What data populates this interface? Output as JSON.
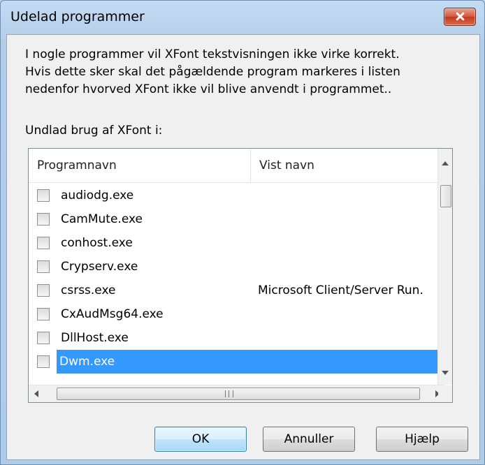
{
  "window": {
    "title": "Udelad programmer"
  },
  "description": [
    "I nogle programmer vil XFont tekstvisningen ikke virke korrekt.",
    "Hvis dette sker skal det pågældende program markeres i listen",
    "nedenfor hvorved XFont ikke vil blive anvendt i programmet.."
  ],
  "list_label": "Undlad brug af XFont i:",
  "columns": [
    "Programnavn",
    "Vist navn"
  ],
  "rows": [
    {
      "name": "audiodg.exe",
      "display": "",
      "checked": false,
      "selected": false
    },
    {
      "name": "CamMute.exe",
      "display": "",
      "checked": false,
      "selected": false
    },
    {
      "name": "conhost.exe",
      "display": "",
      "checked": false,
      "selected": false
    },
    {
      "name": "Crypserv.exe",
      "display": "",
      "checked": false,
      "selected": false
    },
    {
      "name": "csrss.exe",
      "display": "Microsoft Client/Server Run.",
      "checked": false,
      "selected": false
    },
    {
      "name": "CxAudMsg64.exe",
      "display": "",
      "checked": false,
      "selected": false
    },
    {
      "name": "DllHost.exe",
      "display": "",
      "checked": false,
      "selected": false
    },
    {
      "name": "Dwm.exe",
      "display": "",
      "checked": false,
      "selected": true
    }
  ],
  "buttons": {
    "ok": "OK",
    "cancel": "Annuller",
    "help": "Hjælp"
  },
  "colors": {
    "selection": "#3399ff",
    "close_button": "#c3391f"
  }
}
